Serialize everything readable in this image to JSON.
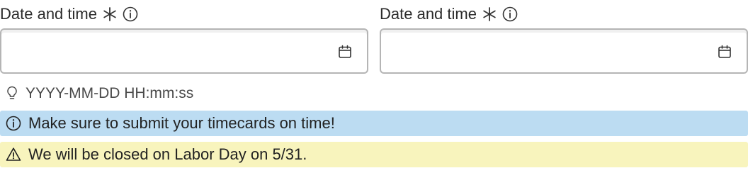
{
  "fields": [
    {
      "label": "Date and time",
      "required_icon": "asterisk-icon",
      "info_icon": "info-icon",
      "value": "",
      "picker_icon": "calendar-icon"
    },
    {
      "label": "Date and time",
      "required_icon": "asterisk-icon",
      "info_icon": "info-icon",
      "value": "",
      "picker_icon": "calendar-icon"
    }
  ],
  "hint": {
    "icon": "lightbulb-icon",
    "text": "YYYY-MM-DD HH:mm:ss"
  },
  "banners": [
    {
      "kind": "info",
      "icon": "info-icon",
      "text": "Make sure to submit your timecards on time!",
      "color": "#bcdcf2"
    },
    {
      "kind": "warning",
      "icon": "warning-icon",
      "text": "We will be closed on Labor Day on 5/31.",
      "color": "#f8f4bd"
    }
  ]
}
